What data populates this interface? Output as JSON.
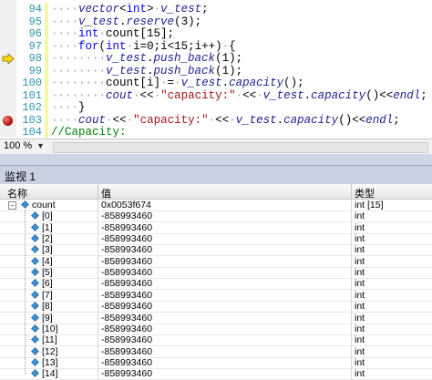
{
  "editor": {
    "lines": [
      {
        "num": "94",
        "bp": false,
        "arrow": false,
        "html": "<span class='dots'>····</span><span class='var'>vector</span>&lt;<span class='kw'>int</span>&gt;<span class='dots'>·</span><span class='var'>v_test</span>;"
      },
      {
        "num": "95",
        "bp": false,
        "arrow": false,
        "html": "<span class='dots'>····</span><span class='var'>v_test</span>.<span class='var'>reserve</span>(3);"
      },
      {
        "num": "96",
        "bp": false,
        "arrow": false,
        "html": "<span class='dots'>····</span><span class='kw'>int</span><span class='dots'>·</span>count[15];"
      },
      {
        "num": "97",
        "bp": false,
        "arrow": false,
        "html": "<span class='dots'>····</span><span class='kw'>for</span>(<span class='kw'>int</span><span class='dots'>·</span>i=0;i&lt;15;i++)<span class='dots'>·</span>{"
      },
      {
        "num": "98",
        "bp": false,
        "arrow": true,
        "html": "<span class='dots'>········</span><span class='var'>v_test</span>.<span class='var'>push_back</span>(1);"
      },
      {
        "num": "99",
        "bp": false,
        "arrow": false,
        "html": "<span class='dots'>········</span><span class='var'>v_test</span>.<span class='var'>push_back</span>(1);"
      },
      {
        "num": "100",
        "bp": false,
        "arrow": false,
        "html": "<span class='dots'>········</span>count[i]<span class='dots'>·</span>=<span class='dots'>·</span><span class='var'>v_test</span>.<span class='var'>capacity</span>();"
      },
      {
        "num": "101",
        "bp": false,
        "arrow": false,
        "html": "<span class='dots'>········</span><span class='var'>cout</span><span class='dots'>·</span>&lt;&lt;<span class='dots'>·</span><span class='str'>\"capacity:\"</span><span class='dots'>·</span>&lt;&lt;<span class='dots'>·</span><span class='var'>v_test</span>.<span class='var'>capacity</span>()&lt;&lt;<span class='var'>endl</span>;"
      },
      {
        "num": "102",
        "bp": false,
        "arrow": false,
        "html": "<span class='dots'>····</span>}"
      },
      {
        "num": "103",
        "bp": true,
        "arrow": false,
        "html": "<span class='dots'>····</span><span class='var'>cout</span><span class='dots'>·</span>&lt;&lt;<span class='dots'>·</span><span class='str'>\"capacity:\"</span><span class='dots'>·</span>&lt;&lt;<span class='dots'>·</span><span class='var'>v_test</span>.<span class='var'>capacity</span>()&lt;&lt;<span class='var'>endl</span>;"
      },
      {
        "num": "104",
        "bp": false,
        "arrow": false,
        "html": "<span class='cmt'>//Capacity:</span>"
      }
    ],
    "zoom": "100 %"
  },
  "watch": {
    "title": "监视 1",
    "headers": {
      "name": "名称",
      "value": "值",
      "type": "类型"
    },
    "root": {
      "name": "count",
      "value": "0x0053f674",
      "type": "int [15]"
    },
    "items": [
      {
        "name": "[0]",
        "value": "-858993460",
        "type": "int"
      },
      {
        "name": "[1]",
        "value": "-858993460",
        "type": "int"
      },
      {
        "name": "[2]",
        "value": "-858993460",
        "type": "int"
      },
      {
        "name": "[3]",
        "value": "-858993460",
        "type": "int"
      },
      {
        "name": "[4]",
        "value": "-858993460",
        "type": "int"
      },
      {
        "name": "[5]",
        "value": "-858993460",
        "type": "int"
      },
      {
        "name": "[6]",
        "value": "-858993460",
        "type": "int"
      },
      {
        "name": "[7]",
        "value": "-858993460",
        "type": "int"
      },
      {
        "name": "[8]",
        "value": "-858993460",
        "type": "int"
      },
      {
        "name": "[9]",
        "value": "-858993460",
        "type": "int"
      },
      {
        "name": "[10]",
        "value": "-858993460",
        "type": "int"
      },
      {
        "name": "[11]",
        "value": "-858993460",
        "type": "int"
      },
      {
        "name": "[12]",
        "value": "-858993460",
        "type": "int"
      },
      {
        "name": "[13]",
        "value": "-858993460",
        "type": "int"
      },
      {
        "name": "[14]",
        "value": "-858993460",
        "type": "int"
      }
    ]
  },
  "colors": {
    "breakpoint": "#c00000",
    "line_number": "#2b91af",
    "keyword": "#0000ff",
    "string": "#a31515",
    "comment": "#008000"
  }
}
